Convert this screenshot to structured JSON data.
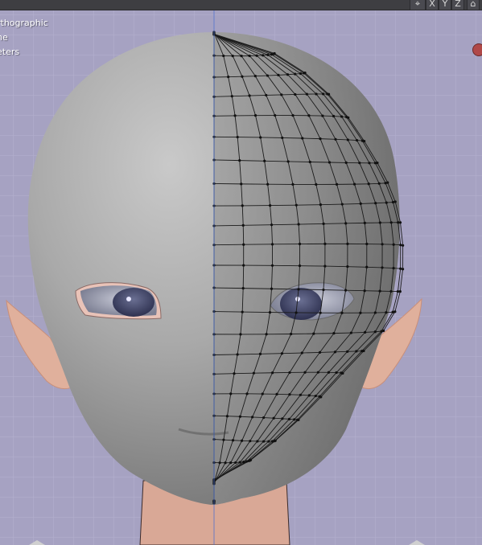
{
  "viewport": {
    "overlay": {
      "line1": "rthographic",
      "line2": "ne",
      "line3": "eters"
    },
    "header": {
      "buttons": [
        "⌖",
        "X",
        "Y",
        "Z",
        "⌂"
      ]
    }
  },
  "colors": {
    "background": "#a6a2c2",
    "grid": "#b4b0cf",
    "head": "#8e8e8e",
    "skin": "#dca996",
    "wire": "#1b1b1b",
    "axis": "#4a6fcf"
  },
  "icons": [
    "gizmo-icon",
    "record-dot-icon"
  ]
}
